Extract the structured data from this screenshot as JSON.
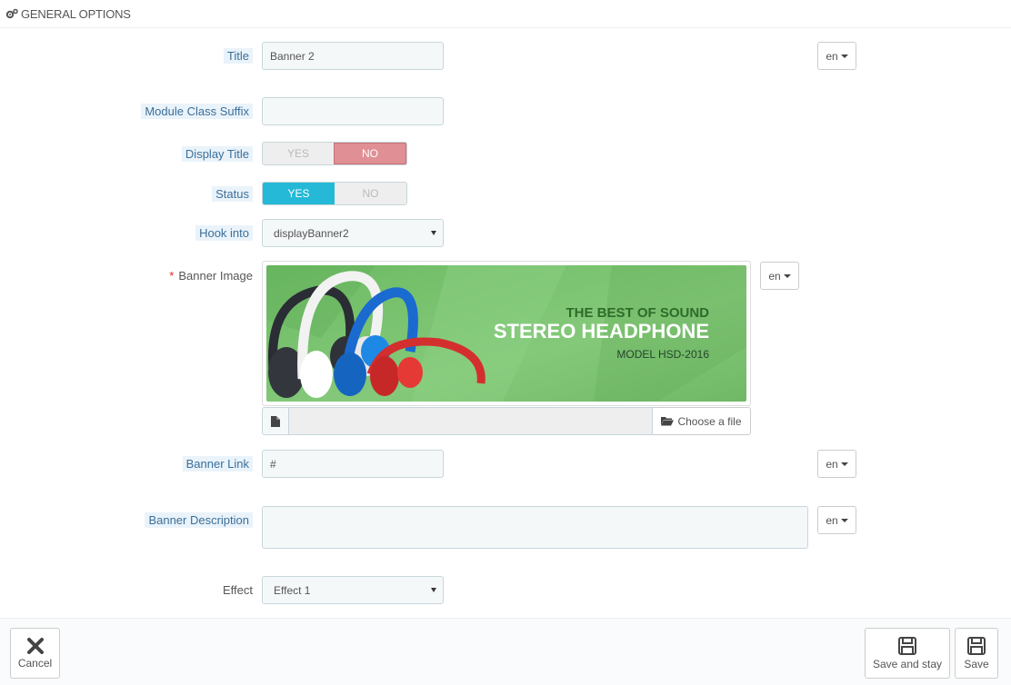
{
  "panel": {
    "title": "GENERAL OPTIONS",
    "icon": "gears-icon"
  },
  "fields": {
    "title": {
      "label": "Title",
      "value": "Banner 2",
      "lang": "en"
    },
    "module_class_suffix": {
      "label": "Module Class Suffix",
      "value": ""
    },
    "display_title": {
      "label": "Display Title",
      "yes": "YES",
      "no": "NO",
      "selected": "NO"
    },
    "status": {
      "label": "Status",
      "yes": "YES",
      "no": "NO",
      "selected": "YES"
    },
    "hook_into": {
      "label": "Hook into",
      "value": "displayBanner2"
    },
    "banner_image": {
      "label": "Banner Image",
      "required_mark": "*",
      "lang": "en",
      "choose_label": "Choose a file",
      "banner_text": {
        "line1": "THE BEST OF SOUND",
        "line2": "STEREO HEADPHONE",
        "line3": "MODEL HSD-2016"
      }
    },
    "banner_link": {
      "label": "Banner Link",
      "value": "#",
      "lang": "en"
    },
    "banner_description": {
      "label": "Banner Description",
      "value": "",
      "lang": "en"
    },
    "effect": {
      "label": "Effect",
      "value": "Effect 1"
    }
  },
  "footer": {
    "cancel_label": "Cancel",
    "save_stay_label": "Save and stay",
    "save_label": "Save"
  },
  "colors": {
    "accent": "#25b9d7",
    "no_active": "#e08f95",
    "banner_green": "#7cc576",
    "headphone_blue": "#1565c0",
    "headphone_red": "#d32f2f"
  }
}
